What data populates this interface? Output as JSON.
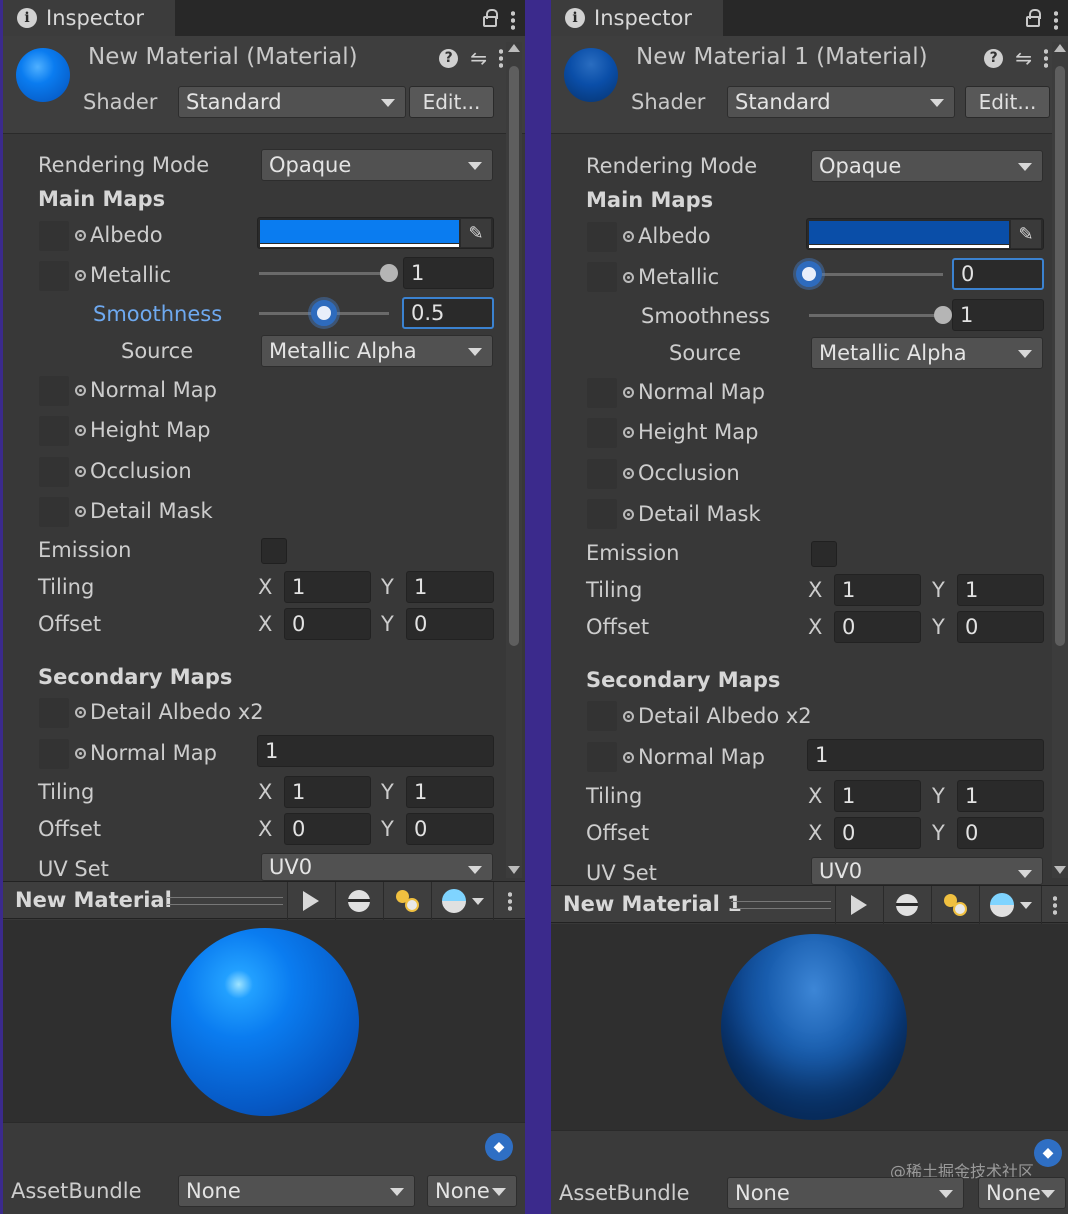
{
  "left": {
    "tab_title": "Inspector",
    "material_title": "New Material (Material)",
    "shader_label": "Shader",
    "shader_value": "Standard",
    "edit_label": "Edit...",
    "albedo_color": "#0a7cf0",
    "rendering_mode_label": "Rendering Mode",
    "rendering_mode_value": "Opaque",
    "main_maps_label": "Main Maps",
    "albedo_label": "Albedo",
    "metallic_label": "Metallic",
    "metallic_value": "1",
    "metallic_level": 1.0,
    "smoothness_label": "Smoothness",
    "smoothness_value": "0.5",
    "smoothness_level": 0.5,
    "source_label": "Source",
    "source_value": "Metallic Alpha",
    "normal_map_label": "Normal Map",
    "height_map_label": "Height Map",
    "occlusion_label": "Occlusion",
    "detail_mask_label": "Detail Mask",
    "emission_label": "Emission",
    "tiling_label": "Tiling",
    "tiling_x": "1",
    "tiling_y": "1",
    "offset_label": "Offset",
    "offset_x": "0",
    "offset_y": "0",
    "secondary_maps_label": "Secondary Maps",
    "detail_albedo_label": "Detail Albedo x2",
    "sec_normal_map_label": "Normal Map",
    "sec_normal_value": "1",
    "sec_tiling_label": "Tiling",
    "sec_tiling_x": "1",
    "sec_tiling_y": "1",
    "sec_offset_label": "Offset",
    "sec_offset_x": "0",
    "sec_offset_y": "0",
    "uv_set_label": "UV Set",
    "uv_set_value": "UV0",
    "x_label": "X",
    "y_label": "Y",
    "preview_title": "New Material",
    "assetbundle_label": "AssetBundle",
    "assetbundle_value": "None",
    "assetbundle_variant": "None"
  },
  "right": {
    "tab_title": "Inspector",
    "material_title": "New Material 1 (Material)",
    "shader_label": "Shader",
    "shader_value": "Standard",
    "edit_label": "Edit...",
    "albedo_color": "#0a4ea8",
    "rendering_mode_label": "Rendering Mode",
    "rendering_mode_value": "Opaque",
    "main_maps_label": "Main Maps",
    "albedo_label": "Albedo",
    "metallic_label": "Metallic",
    "metallic_value": "0",
    "metallic_level": 0.0,
    "smoothness_label": "Smoothness",
    "smoothness_value": "1",
    "smoothness_level": 1.0,
    "source_label": "Source",
    "source_value": "Metallic Alpha",
    "normal_map_label": "Normal Map",
    "height_map_label": "Height Map",
    "occlusion_label": "Occlusion",
    "detail_mask_label": "Detail Mask",
    "emission_label": "Emission",
    "tiling_label": "Tiling",
    "tiling_x": "1",
    "tiling_y": "1",
    "offset_label": "Offset",
    "offset_x": "0",
    "offset_y": "0",
    "secondary_maps_label": "Secondary Maps",
    "detail_albedo_label": "Detail Albedo x2",
    "sec_normal_map_label": "Normal Map",
    "sec_normal_value": "1",
    "sec_tiling_label": "Tiling",
    "sec_tiling_x": "1",
    "sec_tiling_y": "1",
    "sec_offset_label": "Offset",
    "sec_offset_x": "0",
    "sec_offset_y": "0",
    "uv_set_label": "UV Set",
    "uv_set_value": "UV0",
    "x_label": "X",
    "y_label": "Y",
    "preview_title": "New Material 1",
    "assetbundle_label": "AssetBundle",
    "assetbundle_value": "None",
    "assetbundle_variant": "None",
    "watermark": "@稀土掘金技术社区"
  },
  "icons": {
    "info": "i",
    "help": "?",
    "sliders": "⇋",
    "picker": "✎",
    "tag": "◆"
  }
}
